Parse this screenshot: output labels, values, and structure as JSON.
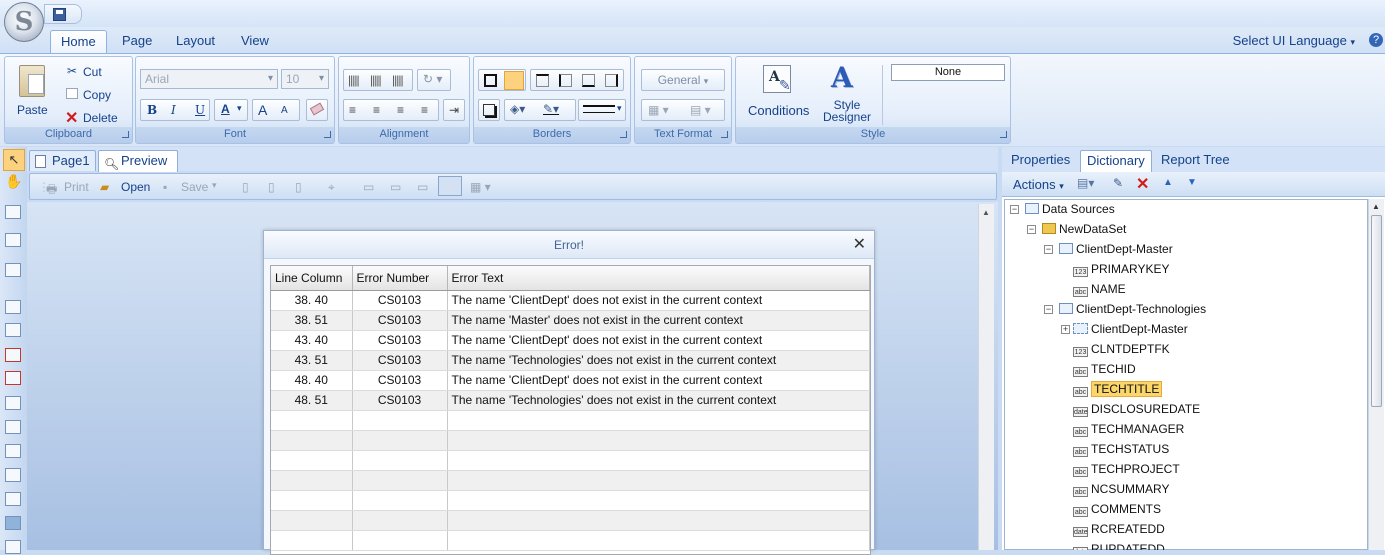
{
  "app": {
    "logo_letter": "S"
  },
  "ribbon_tabs": [
    "Home",
    "Page",
    "Layout",
    "View"
  ],
  "ui_language": "Select UI Language",
  "help": "?",
  "clipboard": {
    "paste": "Paste",
    "cut": "Cut",
    "copy": "Copy",
    "delete": "Delete",
    "label": "Clipboard"
  },
  "font": {
    "family": "Arial",
    "size": "10",
    "bold": "B",
    "italic": "I",
    "underline": "U",
    "color": "A",
    "grow": "A",
    "shrink": "A",
    "label": "Font"
  },
  "alignment": {
    "label": "Alignment"
  },
  "borders": {
    "label": "Borders"
  },
  "text_format": {
    "general": "General",
    "label": "Text Format"
  },
  "style": {
    "conditions": "Conditions",
    "designer_line1": "Style",
    "designer_line2": "Designer",
    "none": "None",
    "label": "Style"
  },
  "doc_tabs": [
    "Page1",
    "Preview"
  ],
  "preview_toolbar": {
    "print": "Print",
    "open": "Open",
    "save": "Save"
  },
  "dialog": {
    "title": "Error!",
    "close": "✕",
    "columns": [
      "Line Column",
      "Error Number",
      "Error Text"
    ],
    "rows": [
      [
        "38. 40",
        "CS0103",
        "The name 'ClientDept' does not exist in the current context"
      ],
      [
        "38. 51",
        "CS0103",
        "The name 'Master' does not exist in the current context"
      ],
      [
        "43. 40",
        "CS0103",
        "The name 'ClientDept' does not exist in the current context"
      ],
      [
        "43. 51",
        "CS0103",
        "The name 'Technologies' does not exist in the current context"
      ],
      [
        "48. 40",
        "CS0103",
        "The name 'ClientDept' does not exist in the current context"
      ],
      [
        "48. 51",
        "CS0103",
        "The name 'Technologies' does not exist in the current context"
      ]
    ]
  },
  "panel_tabs": [
    "Properties",
    "Dictionary",
    "Report Tree"
  ],
  "panel_toolbar": {
    "actions": "Actions"
  },
  "tree": [
    {
      "label": "Data Sources",
      "kind": "datasources",
      "expander": "−"
    },
    {
      "label": "NewDataSet",
      "kind": "dataset",
      "expander": "−"
    },
    {
      "label": "ClientDept-Master",
      "kind": "table",
      "expander": "−"
    },
    {
      "label": "PRIMARYKEY",
      "kind": "field",
      "type_icon": "123"
    },
    {
      "label": "NAME",
      "kind": "field",
      "type_icon": "abc"
    },
    {
      "label": "ClientDept-Technologies",
      "kind": "table",
      "expander": "−"
    },
    {
      "label": "ClientDept-Master",
      "kind": "relation",
      "expander": "+"
    },
    {
      "label": "CLNTDEPTFK",
      "kind": "field",
      "type_icon": "123"
    },
    {
      "label": "TECHID",
      "kind": "field",
      "type_icon": "abc"
    },
    {
      "label": "TECHTITLE",
      "kind": "field",
      "type_icon": "abc",
      "selected": true
    },
    {
      "label": "DISCLOSUREDATE",
      "kind": "field",
      "type_icon": "date"
    },
    {
      "label": "TECHMANAGER",
      "kind": "field",
      "type_icon": "abc"
    },
    {
      "label": "TECHSTATUS",
      "kind": "field",
      "type_icon": "abc"
    },
    {
      "label": "TECHPROJECT",
      "kind": "field",
      "type_icon": "abc"
    },
    {
      "label": "NCSUMMARY",
      "kind": "field",
      "type_icon": "abc"
    },
    {
      "label": "COMMENTS",
      "kind": "field",
      "type_icon": "abc"
    },
    {
      "label": "RCREATEDD",
      "kind": "field",
      "type_icon": "date"
    },
    {
      "label": "RUPDATEDD",
      "kind": "field",
      "type_icon": "date"
    }
  ]
}
